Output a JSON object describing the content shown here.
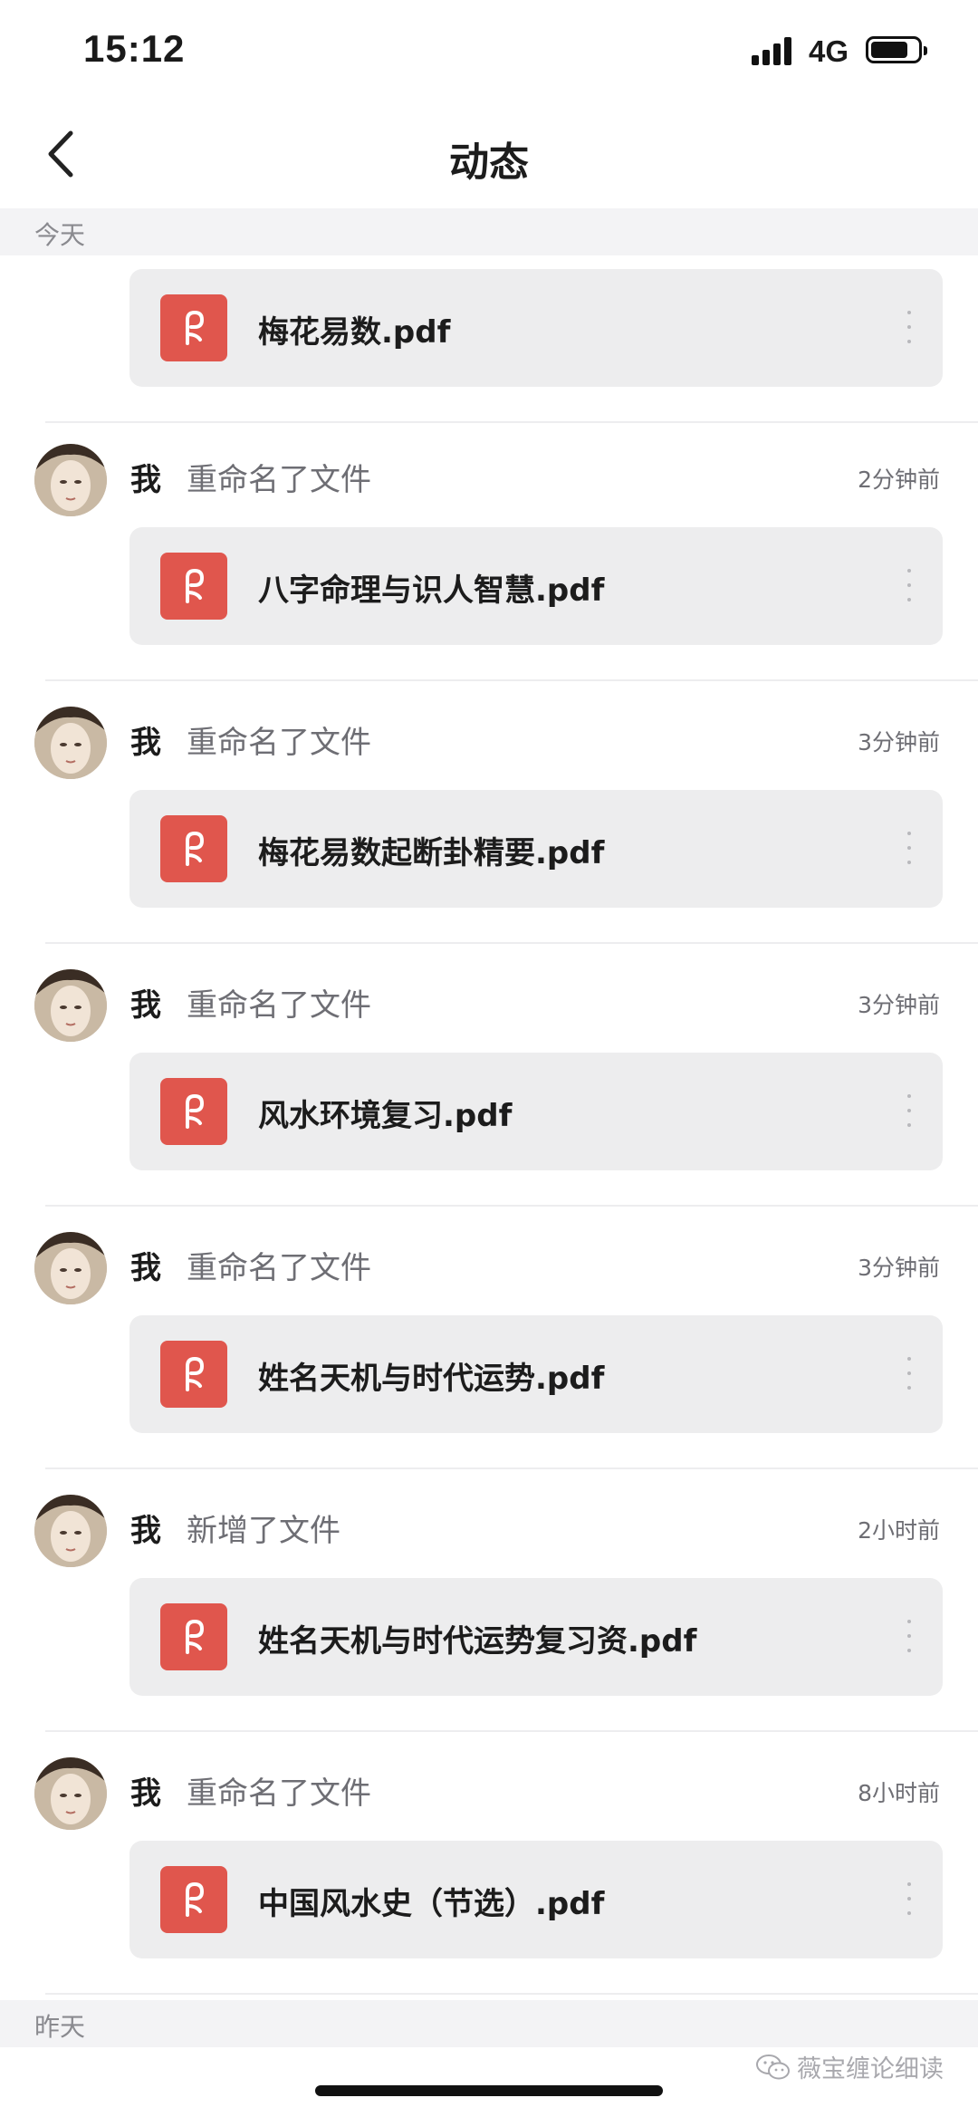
{
  "status_bar": {
    "time": "15:12",
    "network": "4G",
    "battery_level": 0.8
  },
  "nav": {
    "title": "动态",
    "back_icon": "chevron-left-icon"
  },
  "sections": {
    "today": "今天",
    "yesterday": "昨天"
  },
  "top_file": {
    "name": "梅花易数.pdf"
  },
  "feed": [
    {
      "actor": "我",
      "action": "重命名了文件",
      "time": "2分钟前",
      "file": "八字命理与识人智慧.pdf"
    },
    {
      "actor": "我",
      "action": "重命名了文件",
      "time": "3分钟前",
      "file": "梅花易数起断卦精要.pdf"
    },
    {
      "actor": "我",
      "action": "重命名了文件",
      "time": "3分钟前",
      "file": "风水环境复习.pdf"
    },
    {
      "actor": "我",
      "action": "重命名了文件",
      "time": "3分钟前",
      "file": "姓名天机与时代运势.pdf"
    },
    {
      "actor": "我",
      "action": "新增了文件",
      "time": "2小时前",
      "file": "姓名天机与时代运势复习资.pdf"
    },
    {
      "actor": "我",
      "action": "重命名了文件",
      "time": "8小时前",
      "file": "中国风水史（节选）.pdf"
    }
  ],
  "watermark": "薇宝缠论细读",
  "colors": {
    "pdf_icon": "#e0564d",
    "card_bg": "#ededee",
    "section_bg": "#f3f3f5"
  }
}
